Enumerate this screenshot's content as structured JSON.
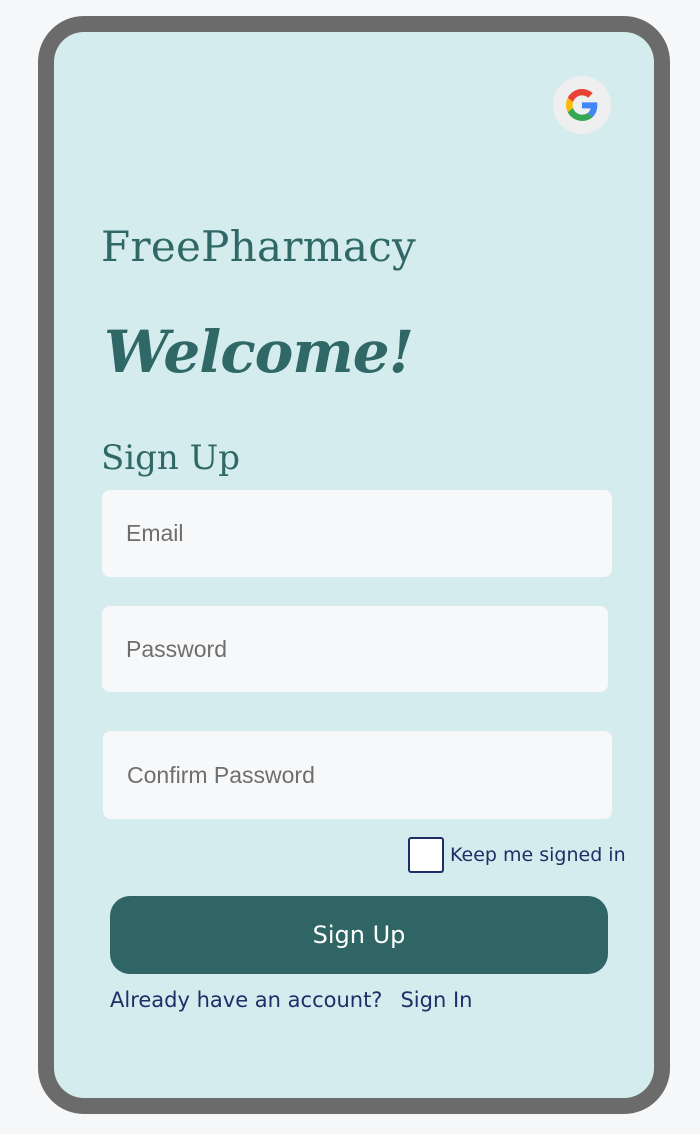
{
  "brand": {
    "name": "FreePharmacy"
  },
  "hero": {
    "welcome": "Welcome!"
  },
  "form": {
    "title": "Sign Up",
    "email_placeholder": "Email",
    "email_value": "",
    "password_placeholder": "Password",
    "password_value": "",
    "confirm_placeholder": "Confirm Password",
    "confirm_value": "",
    "keep_signed_in_label": "Keep me signed in",
    "keep_signed_in_checked": false,
    "submit_label": "Sign Up"
  },
  "footer": {
    "prompt": "Already have an account?",
    "signin_link": "Sign In"
  },
  "icons": {
    "google": "google-icon"
  },
  "colors": {
    "accent": "#2f6564",
    "screen_bg": "#d5ecee",
    "text_dark": "#1d2f66",
    "brand_text": "#2f6866"
  }
}
